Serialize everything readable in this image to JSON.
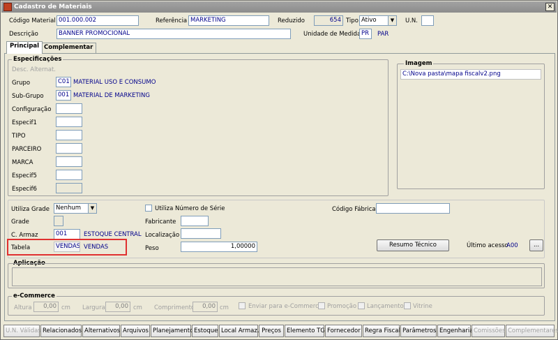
{
  "window": {
    "title": "Cadastro de Materiais",
    "close_label": "✕"
  },
  "header": {
    "codigo_label": "Código Material",
    "codigo_value": "001.000.002",
    "referencia_label": "Referência",
    "referencia_value": "MARKETING",
    "reduzido_label": "Reduzido",
    "reduzido_value": "654",
    "tipo_label": "Tipo",
    "tipo_value": "Ativo",
    "un_label": "U.N.",
    "un_value": "",
    "descricao_label": "Descrição",
    "descricao_value": "BANNER PROMOCIONAL",
    "unidade_label": "Unidade de Medida",
    "unidade_code": "PR",
    "unidade_name": "PAR"
  },
  "tabs": [
    {
      "label": "Principal"
    },
    {
      "label": "Complementar"
    }
  ],
  "especificacoes": {
    "legend": "Especificações",
    "desc_alt_label": "Desc. Alternat.",
    "grupo_label": "Grupo",
    "grupo_code": "C01",
    "grupo_name": "MATERIAL USO E CONSUMO",
    "subgrupo_label": "Sub-Grupo",
    "subgrupo_code": "001",
    "subgrupo_name": "MATERIAL DE MARKETING",
    "configuracao_label": "Configuração",
    "especif1_label": "Especif1",
    "tipo_label": "TIPO",
    "parceiro_label": "PARCEIRO",
    "marca_label": "MARCA",
    "especif5_label": "Especif5",
    "especif6_label": "Especif6"
  },
  "imagem": {
    "legend": "Imagem",
    "path": "C:\\Nova pasta\\mapa fiscalv2.png"
  },
  "middle": {
    "utiliza_grade_label": "Utiliza Grade",
    "utiliza_grade_value": "Nenhum",
    "grade_label": "Grade",
    "c_armaz_label": "C. Armaz",
    "c_armaz_code": "001",
    "c_armaz_name": "ESTOQUE CENTRAL",
    "tabela_label": "Tabela",
    "tabela_code": "VENDAS",
    "tabela_name": "VENDAS",
    "utiliza_serie_label": "Utiliza Número de Série",
    "fabricante_label": "Fabricante",
    "localizacao_label": "Localização",
    "peso_label": "Peso",
    "peso_value": "1,00000",
    "codigo_fabrica_label": "Código Fábrica",
    "resumo_button": "Resumo Técnico",
    "ultimo_acesso_label": "Último acesso",
    "ultimo_acesso_value": "A00",
    "ellipsis_button": "..."
  },
  "aplicacao": {
    "legend": "Aplicação"
  },
  "ecommerce": {
    "legend": "e-Commerce",
    "altura_label": "Altura",
    "altura_value": "0,00",
    "altura_unit": "cm",
    "largura_label": "Largura",
    "largura_value": "0,00",
    "largura_unit": "cm",
    "comprimento_label": "Comprimento",
    "comprimento_value": "0,00",
    "comprimento_unit": "cm",
    "enviar_label": "Enviar para e-Commerce",
    "promocao_label": "Promoção",
    "lancamento_label": "Lançamento",
    "vitrine_label": "Vitrine"
  },
  "bottom_buttons": [
    {
      "label": "U.N. Válidas"
    },
    {
      "label": "Relacionados"
    },
    {
      "label": "Alternativos"
    },
    {
      "label": "Arquivos"
    },
    {
      "label": "Planejamento"
    },
    {
      "label": "Estoque"
    },
    {
      "label": "Local Armaz."
    },
    {
      "label": "Preços"
    },
    {
      "label": "Elemento TG"
    },
    {
      "label": "Fornecedor"
    },
    {
      "label": "Regra Fiscal"
    },
    {
      "label": "Parâmetros"
    },
    {
      "label": "Engenharia"
    },
    {
      "label": "Comissões"
    },
    {
      "label": "Complementares"
    }
  ],
  "colors": {
    "value_text": "#00008b",
    "highlight_box": "#e03030"
  }
}
